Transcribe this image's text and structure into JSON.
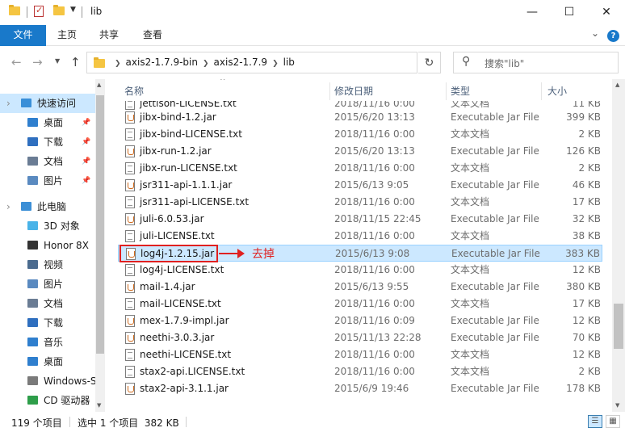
{
  "window": {
    "title": "lib",
    "minimize": "—",
    "maximize": "☐",
    "close": "✕"
  },
  "ribbon": {
    "tabs": [
      "文件",
      "主页",
      "共享",
      "查看"
    ],
    "expand": "⌄",
    "help": "?"
  },
  "address": {
    "crumbs": [
      "axis2-1.7.9-bin",
      "axis2-1.7.9",
      "lib"
    ],
    "search_placeholder": "搜索\"lib\""
  },
  "nav": {
    "items": [
      {
        "label": "快速访问",
        "icon": "star-icon",
        "color": "#3a8fd8",
        "selected": true,
        "indent": 0,
        "pinned": false
      },
      {
        "label": "桌面",
        "icon": "desktop-icon",
        "color": "#2f7fce",
        "selected": false,
        "indent": 1,
        "pinned": true
      },
      {
        "label": "下载",
        "icon": "download-icon",
        "color": "#2f6fbf",
        "selected": false,
        "indent": 1,
        "pinned": true
      },
      {
        "label": "文档",
        "icon": "document-icon",
        "color": "#6a7c94",
        "selected": false,
        "indent": 1,
        "pinned": true
      },
      {
        "label": "图片",
        "icon": "pictures-icon",
        "color": "#5a8ac0",
        "selected": false,
        "indent": 1,
        "pinned": true
      },
      {
        "label": "此电脑",
        "icon": "computer-icon",
        "color": "#3c8fd6",
        "selected": false,
        "indent": 0,
        "pinned": false
      },
      {
        "label": "3D 对象",
        "icon": "3d-objects-icon",
        "color": "#49b3e8",
        "selected": false,
        "indent": 1,
        "pinned": false
      },
      {
        "label": "Honor 8X",
        "icon": "phone-icon",
        "color": "#333333",
        "selected": false,
        "indent": 1,
        "pinned": false
      },
      {
        "label": "视频",
        "icon": "video-icon",
        "color": "#4b6b8f",
        "selected": false,
        "indent": 1,
        "pinned": false
      },
      {
        "label": "图片",
        "icon": "pictures-icon",
        "color": "#5a8ac0",
        "selected": false,
        "indent": 1,
        "pinned": false
      },
      {
        "label": "文档",
        "icon": "document-icon",
        "color": "#6a7c94",
        "selected": false,
        "indent": 1,
        "pinned": false
      },
      {
        "label": "下载",
        "icon": "download-icon",
        "color": "#2f6fbf",
        "selected": false,
        "indent": 1,
        "pinned": false
      },
      {
        "label": "音乐",
        "icon": "music-icon",
        "color": "#2f7fce",
        "selected": false,
        "indent": 1,
        "pinned": false
      },
      {
        "label": "桌面",
        "icon": "desktop-icon",
        "color": "#2f7fce",
        "selected": false,
        "indent": 1,
        "pinned": false
      },
      {
        "label": "Windows-S",
        "icon": "drive-icon",
        "color": "#7a7a7a",
        "selected": false,
        "indent": 1,
        "pinned": false
      },
      {
        "label": "CD 驱动器",
        "icon": "cd-drive-icon",
        "color": "#2e9e4a",
        "selected": false,
        "indent": 1,
        "pinned": false
      }
    ]
  },
  "columns": {
    "name": "名称",
    "date": "修改日期",
    "type": "类型",
    "size": "大小"
  },
  "files": [
    {
      "name": "jettison-LICENSE.txt",
      "date": "2018/11/16 0:00",
      "type": "文本文档",
      "size": "11 KB",
      "kind": "txt",
      "selected": false
    },
    {
      "name": "jibx-bind-1.2.jar",
      "date": "2015/6/20 13:13",
      "type": "Executable Jar File",
      "size": "399 KB",
      "kind": "jar",
      "selected": false
    },
    {
      "name": "jibx-bind-LICENSE.txt",
      "date": "2018/11/16 0:00",
      "type": "文本文档",
      "size": "2 KB",
      "kind": "txt",
      "selected": false
    },
    {
      "name": "jibx-run-1.2.jar",
      "date": "2015/6/20 13:13",
      "type": "Executable Jar File",
      "size": "126 KB",
      "kind": "jar",
      "selected": false
    },
    {
      "name": "jibx-run-LICENSE.txt",
      "date": "2018/11/16 0:00",
      "type": "文本文档",
      "size": "2 KB",
      "kind": "txt",
      "selected": false
    },
    {
      "name": "jsr311-api-1.1.1.jar",
      "date": "2015/6/13 9:05",
      "type": "Executable Jar File",
      "size": "46 KB",
      "kind": "jar",
      "selected": false
    },
    {
      "name": "jsr311-api-LICENSE.txt",
      "date": "2018/11/16 0:00",
      "type": "文本文档",
      "size": "17 KB",
      "kind": "txt",
      "selected": false
    },
    {
      "name": "juli-6.0.53.jar",
      "date": "2018/11/15 22:45",
      "type": "Executable Jar File",
      "size": "32 KB",
      "kind": "jar",
      "selected": false
    },
    {
      "name": "juli-LICENSE.txt",
      "date": "2018/11/16 0:00",
      "type": "文本文档",
      "size": "38 KB",
      "kind": "txt",
      "selected": false
    },
    {
      "name": "log4j-1.2.15.jar",
      "date": "2015/6/13 9:08",
      "type": "Executable Jar File",
      "size": "383 KB",
      "kind": "jar",
      "selected": true
    },
    {
      "name": "log4j-LICENSE.txt",
      "date": "2018/11/16 0:00",
      "type": "文本文档",
      "size": "12 KB",
      "kind": "txt",
      "selected": false
    },
    {
      "name": "mail-1.4.jar",
      "date": "2015/6/13 9:55",
      "type": "Executable Jar File",
      "size": "380 KB",
      "kind": "jar",
      "selected": false
    },
    {
      "name": "mail-LICENSE.txt",
      "date": "2018/11/16 0:00",
      "type": "文本文档",
      "size": "17 KB",
      "kind": "txt",
      "selected": false
    },
    {
      "name": "mex-1.7.9-impl.jar",
      "date": "2018/11/16 0:09",
      "type": "Executable Jar File",
      "size": "12 KB",
      "kind": "jar",
      "selected": false
    },
    {
      "name": "neethi-3.0.3.jar",
      "date": "2015/11/13 22:28",
      "type": "Executable Jar File",
      "size": "70 KB",
      "kind": "jar",
      "selected": false
    },
    {
      "name": "neethi-LICENSE.txt",
      "date": "2018/11/16 0:00",
      "type": "文本文档",
      "size": "12 KB",
      "kind": "txt",
      "selected": false
    },
    {
      "name": "stax2-api.LICENSE.txt",
      "date": "2018/11/16 0:00",
      "type": "文本文档",
      "size": "2 KB",
      "kind": "txt",
      "selected": false
    },
    {
      "name": "stax2-api-3.1.1.jar",
      "date": "2015/6/9 19:46",
      "type": "Executable Jar File",
      "size": "178 KB",
      "kind": "jar",
      "selected": false
    }
  ],
  "annotation": {
    "text": "去掉",
    "color": "#e02020"
  },
  "status": {
    "count": "119 个项目",
    "selection": "选中 1 个项目  382 KB"
  },
  "colors": {
    "accent": "#1979ca",
    "selection": "#cce8ff"
  }
}
